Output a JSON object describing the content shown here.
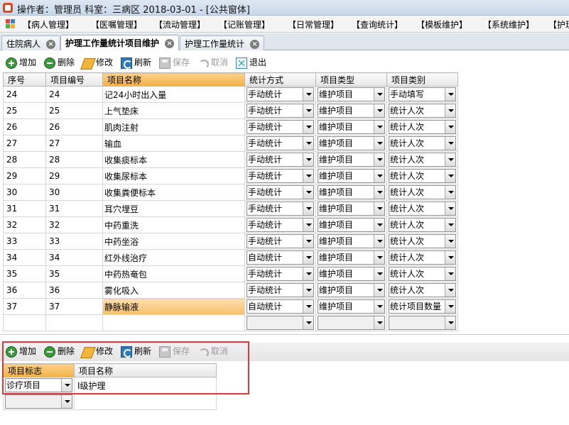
{
  "window": {
    "title": "操作者：管理员 科室：三病区  2018-03-01 - [公共窗体]"
  },
  "menu": [
    "【病人管理】",
    "【医嘱管理】",
    "【流动管理】",
    "【记账管理】",
    "【日常管理】",
    "【查询统计】",
    "【模板维护】",
    "【系统维护】",
    "【护理"
  ],
  "tabs": [
    {
      "label": "住院病人",
      "active": false
    },
    {
      "label": "护理工作量统计项目维护",
      "active": true
    },
    {
      "label": "护理工作量统计",
      "active": false
    }
  ],
  "toolbar": {
    "add": "增加",
    "delete": "删除",
    "edit": "修改",
    "refresh": "刷新",
    "save": "保存",
    "cancel": "取消",
    "exit": "退出"
  },
  "grid": {
    "headers": [
      "序号",
      "项目编号",
      "项目名称",
      "统计方式",
      "项目类型",
      "项目类别"
    ],
    "rows": [
      {
        "seq": "24",
        "code": "24",
        "name": "记24小时出入量",
        "method": "手动统计",
        "type": "维护项目",
        "cat": "手动填写"
      },
      {
        "seq": "25",
        "code": "25",
        "name": "上气垫床",
        "method": "手动统计",
        "type": "维护项目",
        "cat": "统计人次"
      },
      {
        "seq": "26",
        "code": "26",
        "name": "肌肉注射",
        "method": "手动统计",
        "type": "维护项目",
        "cat": "统计人次"
      },
      {
        "seq": "27",
        "code": "27",
        "name": "输血",
        "method": "手动统计",
        "type": "维护项目",
        "cat": "统计人次"
      },
      {
        "seq": "28",
        "code": "28",
        "name": "收集痰标本",
        "method": "手动统计",
        "type": "维护项目",
        "cat": "统计人次"
      },
      {
        "seq": "29",
        "code": "29",
        "name": "收集尿标本",
        "method": "手动统计",
        "type": "维护项目",
        "cat": "统计人次"
      },
      {
        "seq": "30",
        "code": "30",
        "name": "收集粪便标本",
        "method": "手动统计",
        "type": "维护项目",
        "cat": "统计人次"
      },
      {
        "seq": "31",
        "code": "31",
        "name": "耳穴埋豆",
        "method": "手动统计",
        "type": "维护项目",
        "cat": "统计人次"
      },
      {
        "seq": "32",
        "code": "32",
        "name": "中药重洗",
        "method": "手动统计",
        "type": "维护项目",
        "cat": "统计人次"
      },
      {
        "seq": "33",
        "code": "33",
        "name": "中药坐浴",
        "method": "手动统计",
        "type": "维护项目",
        "cat": "统计人次"
      },
      {
        "seq": "34",
        "code": "34",
        "name": "红外线治疗",
        "method": "自动统计",
        "type": "维护项目",
        "cat": "统计人次"
      },
      {
        "seq": "35",
        "code": "35",
        "name": "中药热奄包",
        "method": "手动统计",
        "type": "维护项目",
        "cat": "统计人次"
      },
      {
        "seq": "36",
        "code": "36",
        "name": "雾化吸入",
        "method": "手动统计",
        "type": "维护项目",
        "cat": "统计人次"
      },
      {
        "seq": "37",
        "code": "37",
        "name": "静脉输液",
        "method": "自动统计",
        "type": "维护项目",
        "cat": "统计项目数量"
      }
    ]
  },
  "lower_toolbar": {
    "add": "增加",
    "delete": "删除",
    "edit": "修改",
    "refresh": "刷新",
    "save": "保存",
    "cancel": "取消"
  },
  "lower_grid": {
    "headers": [
      "项目标志",
      "项目名称"
    ],
    "rows": [
      {
        "flag": "诊疗项目",
        "name": "Ⅰ级护理"
      }
    ]
  }
}
